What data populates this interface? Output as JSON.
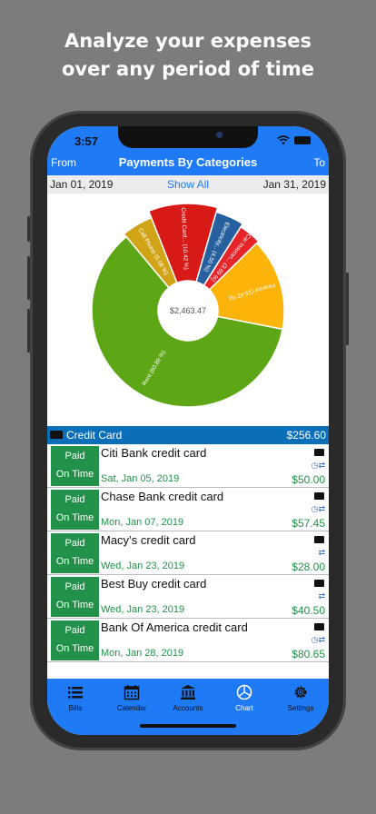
{
  "headline": {
    "line1": "Analyze your expenses",
    "line2": "over any period of time"
  },
  "status": {
    "time": "3:57"
  },
  "nav": {
    "left": "From",
    "title": "Payments By Categories",
    "right": "To"
  },
  "dates": {
    "start": "Jan 01, 2019",
    "show_all": "Show All",
    "end": "Jan 31, 2019"
  },
  "chart_data": {
    "type": "pie",
    "center_label": "$2,463.47",
    "slices": [
      {
        "label": "Rent (60.89 %)",
        "value": 60.89,
        "color": "#5da615"
      },
      {
        "label": "Cell Phone (5.08 %)",
        "value": 5.08,
        "color": "#d1a316"
      },
      {
        "label": "Credit Card... (10.42 %)",
        "value": 10.42,
        "color": "#d71a18"
      },
      {
        "label": "Electricity... (4.50 %)",
        "value": 4.5,
        "color": "#26609e"
      },
      {
        "label": "Car Insuran... (3.69 %)",
        "value": 3.69,
        "color": "#e5252a"
      },
      {
        "label": "Finance (15.42 %)",
        "value": 15.42,
        "color": "#fdb40a"
      }
    ]
  },
  "category": {
    "name": "Credit Card",
    "total": "$256.60"
  },
  "bills": [
    {
      "status1": "Paid",
      "status2": "On Time",
      "name": "Citi Bank credit card",
      "date": "Sat, Jan 05, 2019",
      "amount": "$50.00"
    },
    {
      "status1": "Paid",
      "status2": "On Time",
      "name": "Chase Bank credit card",
      "date": "Mon, Jan 07, 2019",
      "amount": "$57.45"
    },
    {
      "status1": "Paid",
      "status2": "On Time",
      "name": "Macy’s credit card",
      "date": "Wed, Jan 23, 2019",
      "amount": "$28.00"
    },
    {
      "status1": "Paid",
      "status2": "On Time",
      "name": "Best Buy credit card",
      "date": "Wed, Jan 23, 2019",
      "amount": "$40.50"
    },
    {
      "status1": "Paid",
      "status2": "On Time",
      "name": "Bank Of America credit card",
      "date": "Mon, Jan 28, 2019",
      "amount": "$80.65"
    }
  ],
  "tabs": [
    {
      "label": "Bills",
      "icon": "list-icon"
    },
    {
      "label": "Calendar",
      "icon": "calendar-icon"
    },
    {
      "label": "Accounts",
      "icon": "bank-icon"
    },
    {
      "label": "Chart",
      "icon": "pie-chart-icon"
    },
    {
      "label": "Settings",
      "icon": "gear-icon"
    }
  ]
}
